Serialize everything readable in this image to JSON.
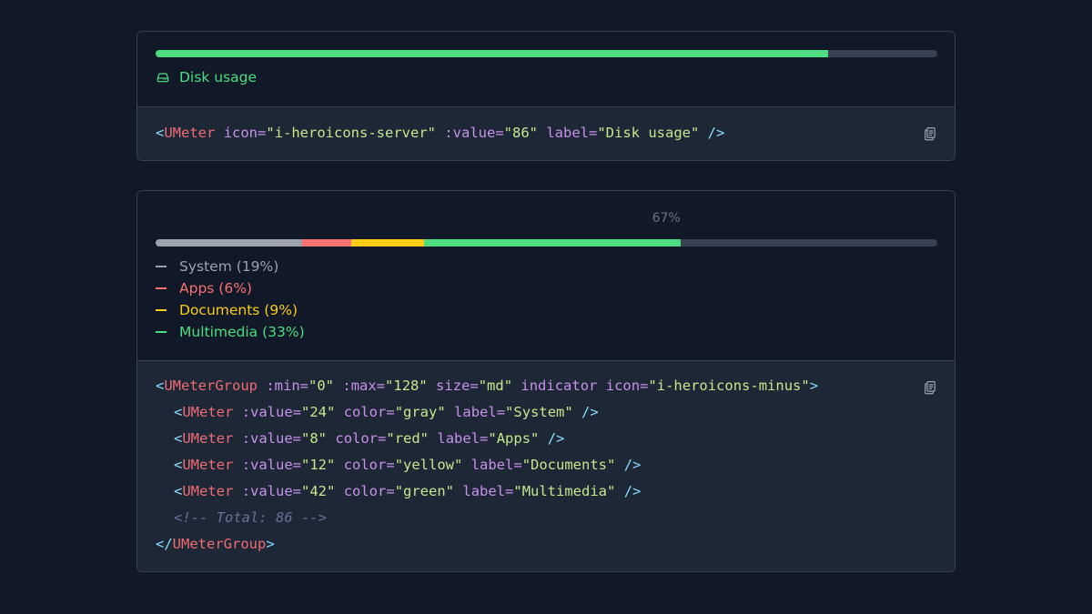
{
  "card1": {
    "meter": {
      "value": 86,
      "max": 100,
      "color": "#4ade80"
    },
    "label": "Disk usage",
    "icon": "server-icon",
    "code": {
      "open": "<",
      "tag": "UMeter",
      "attr_icon": "icon=",
      "val_icon": "\"i-heroicons-server\"",
      "attr_value": ":value=",
      "val_value": "\"86\"",
      "attr_label": "label=",
      "val_label": "\"Disk usage\"",
      "close": "/>"
    }
  },
  "card2": {
    "indicator": "67%",
    "meter_group": {
      "min": 0,
      "max": 128
    },
    "segments": [
      {
        "label": "System (19%)",
        "value": 24,
        "color": "#9ca3af"
      },
      {
        "label": "Apps (6%)",
        "value": 8,
        "color": "#f87171"
      },
      {
        "label": "Documents (9%)",
        "value": 12,
        "color": "#facc15"
      },
      {
        "label": "Multimedia (33%)",
        "value": 42,
        "color": "#4ade80"
      }
    ],
    "code": {
      "l1": {
        "open": "<",
        "tag": "UMeterGroup",
        "a1": ":min=",
        "v1": "\"0\"",
        "a2": ":max=",
        "v2": "\"128\"",
        "a3": "size=",
        "v3": "\"md\"",
        "a4": "indicator",
        "a5": "icon=",
        "v5": "\"i-heroicons-minus\"",
        "close": ">"
      },
      "rows": [
        {
          "open": "<",
          "tag": "UMeter",
          "a1": ":value=",
          "v1": "\"24\"",
          "a2": "color=",
          "v2": "\"gray\"",
          "a3": "label=",
          "v3": "\"System\"",
          "close": "/>"
        },
        {
          "open": "<",
          "tag": "UMeter",
          "a1": ":value=",
          "v1": "\"8\"",
          "a2": "color=",
          "v2": "\"red\"",
          "a3": "label=",
          "v3": "\"Apps\"",
          "close": "/>"
        },
        {
          "open": "<",
          "tag": "UMeter",
          "a1": ":value=",
          "v1": "\"12\"",
          "a2": "color=",
          "v2": "\"yellow\"",
          "a3": "label=",
          "v3": "\"Documents\"",
          "close": "/>"
        },
        {
          "open": "<",
          "tag": "UMeter",
          "a1": ":value=",
          "v1": "\"42\"",
          "a2": "color=",
          "v2": "\"green\"",
          "a3": "label=",
          "v3": "\"Multimedia\"",
          "close": "/>"
        }
      ],
      "comment": "<!-- Total: 86 -->",
      "last": {
        "open": "</",
        "tag": "UMeterGroup",
        "close": ">"
      }
    }
  },
  "colors": {
    "bg": "#111827",
    "code_bg": "#1e2736",
    "border": "#374151",
    "track": "#374151",
    "tag": "#ef6b73",
    "attr": "#c792ea",
    "string": "#c3e88d",
    "punct": "#89ddff",
    "comment": "#697098"
  },
  "icons": {
    "copy": "clipboard-copy-icon",
    "minus": "minus-icon",
    "server": "server-icon"
  }
}
